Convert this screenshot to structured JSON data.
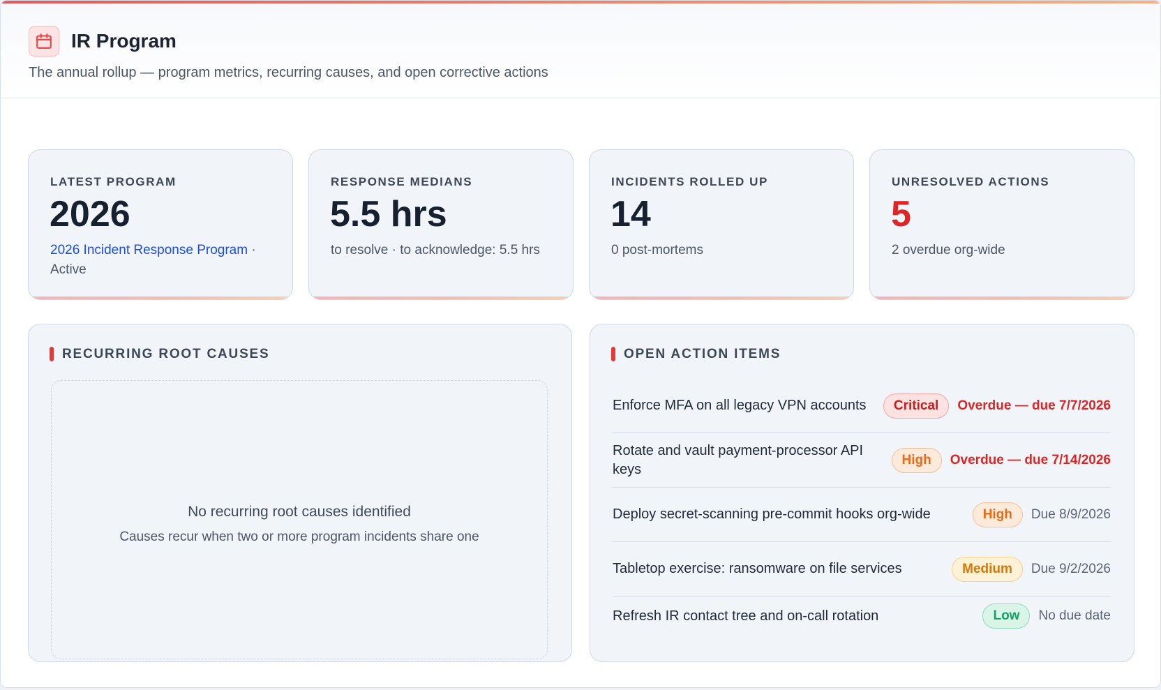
{
  "header": {
    "title": "IR Program",
    "subtitle": "The annual rollup — program metrics, recurring causes, and open corrective actions",
    "icon": "calendar-icon",
    "accent_color": "#e05a5a"
  },
  "stats": [
    {
      "label": "LATEST PROGRAM",
      "value": "2026",
      "link": "2026 Incident Response Program",
      "note": " · Active"
    },
    {
      "label": "RESPONSE MEDIANS",
      "value": "5.5 hrs",
      "note": "to resolve · to acknowledge: 5.5 hrs"
    },
    {
      "label": "INCIDENTS ROLLED UP",
      "value": "14",
      "note": "0 post-mortems"
    },
    {
      "label": "UNRESOLVED ACTIONS",
      "value": "5",
      "note": "2 overdue org-wide",
      "value_color": "#dc2626"
    }
  ],
  "root_causes": {
    "title": "RECURRING ROOT CAUSES",
    "empty_title": "No recurring root causes identified",
    "empty_subtitle": "Causes recur when two or more program incidents share one"
  },
  "action_items": {
    "title": "OPEN ACTION ITEMS",
    "items": [
      {
        "text": "Enforce MFA on all legacy VPN accounts",
        "severity": "Critical",
        "due": "Overdue — due 7/7/2026"
      },
      {
        "text": "Rotate and vault payment-processor API keys",
        "severity": "High",
        "due": "Overdue — due 7/14/2026"
      },
      {
        "text": "Deploy secret-scanning pre-commit hooks org-wide",
        "severity": "High",
        "due": "Due 8/9/2026"
      },
      {
        "text": "Tabletop exercise: ransomware on file services",
        "severity": "Medium",
        "due": "Due 9/2/2026"
      },
      {
        "text": "Refresh IR contact tree and on-call rotation",
        "severity": "Low",
        "due": "No due date"
      }
    ]
  }
}
